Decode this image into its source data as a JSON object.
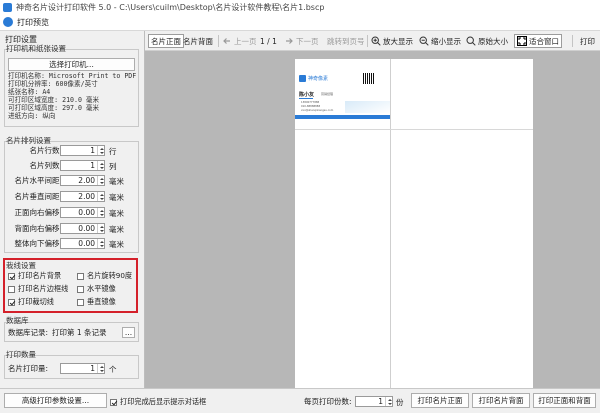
{
  "window": {
    "title": "神奇名片设计打印软件 5.0 - C:\\Users\\cuilm\\Desktop\\名片设计软件教程\\名片1.bscp",
    "dialog_title": "打印预览"
  },
  "left_panel": {
    "title": "打印设置",
    "printer_section": {
      "label": "打印机和纸张设置",
      "select_button": "选择打印机...",
      "info_lines": [
        "打印机名称: Microsoft Print to PDF",
        "打印机分辨率: 600像素/英寸",
        "纸张名称: A4",
        "可打印区域宽度: 210.0 毫米",
        "可打印区域高度: 297.0 毫米",
        "进纸方向: 纵向"
      ]
    },
    "layout_section": {
      "label": "名片排列设置",
      "rows": [
        {
          "label": "名片行数:",
          "value": "1",
          "unit": "行"
        },
        {
          "label": "名片列数:",
          "value": "1",
          "unit": "列"
        },
        {
          "label": "名片水平间距:",
          "value": "2.00",
          "unit": "毫米"
        },
        {
          "label": "名片垂直间距:",
          "value": "2.00",
          "unit": "毫米"
        },
        {
          "label": "正面向右偏移:",
          "value": "0.00",
          "unit": "毫米"
        },
        {
          "label": "背面向右偏移:",
          "value": "0.00",
          "unit": "毫米"
        },
        {
          "label": "整体向下偏移:",
          "value": "0.00",
          "unit": "毫米"
        }
      ]
    },
    "options_section": {
      "label": "栽线设置",
      "checkboxes": [
        {
          "label": "打印名片背景",
          "checked": true
        },
        {
          "label": "名片旋转90度",
          "checked": false
        },
        {
          "label": "打印名片边框线",
          "checked": false
        },
        {
          "label": "水平镜像",
          "checked": false
        },
        {
          "label": "打印裁切线",
          "checked": true
        },
        {
          "label": "垂直镜像",
          "checked": false
        }
      ]
    },
    "database_section": {
      "label": "数据库",
      "record_label": "数据库记录:",
      "record_value": "打印第 1 条记录",
      "more_button": "..."
    },
    "copies_section": {
      "label": "打印数量",
      "copies_label": "名片打印量:",
      "copies_value": "1",
      "copies_unit": "个"
    }
  },
  "toolbar": {
    "front": "名片正面",
    "back": "名片背面",
    "prev_page": "上一页",
    "page_indicator": "1 / 1",
    "next_page": "下一页",
    "jump_page": "跳转到页号",
    "zoom_in": "放大显示",
    "zoom_out": "缩小显示",
    "original_size": "原始大小",
    "fit_window": "适合窗口",
    "print": "打印"
  },
  "preview_card": {
    "brand": "神奇像素",
    "name": "陈小友",
    "job": "营销经理",
    "phone": "13800777888",
    "tel": "010-88888888",
    "email": "xxx@shenqixiangsu.com"
  },
  "bottom_bar": {
    "advanced_button": "高级打印参数设置...",
    "close_after_print_label": "打印完成后显示提示对话框",
    "close_after_print_checked": true,
    "per_page_label": "每页打印份数:",
    "per_page_value": "1",
    "per_page_unit": "份",
    "print_front": "打印名片正面",
    "print_back": "打印名片背面",
    "print_both": "打印正面和背面"
  },
  "colors": {
    "accent_blue": "#2a7bd6",
    "highlight_red": "#d4202a",
    "canvas_gray": "#b7b7b7"
  }
}
